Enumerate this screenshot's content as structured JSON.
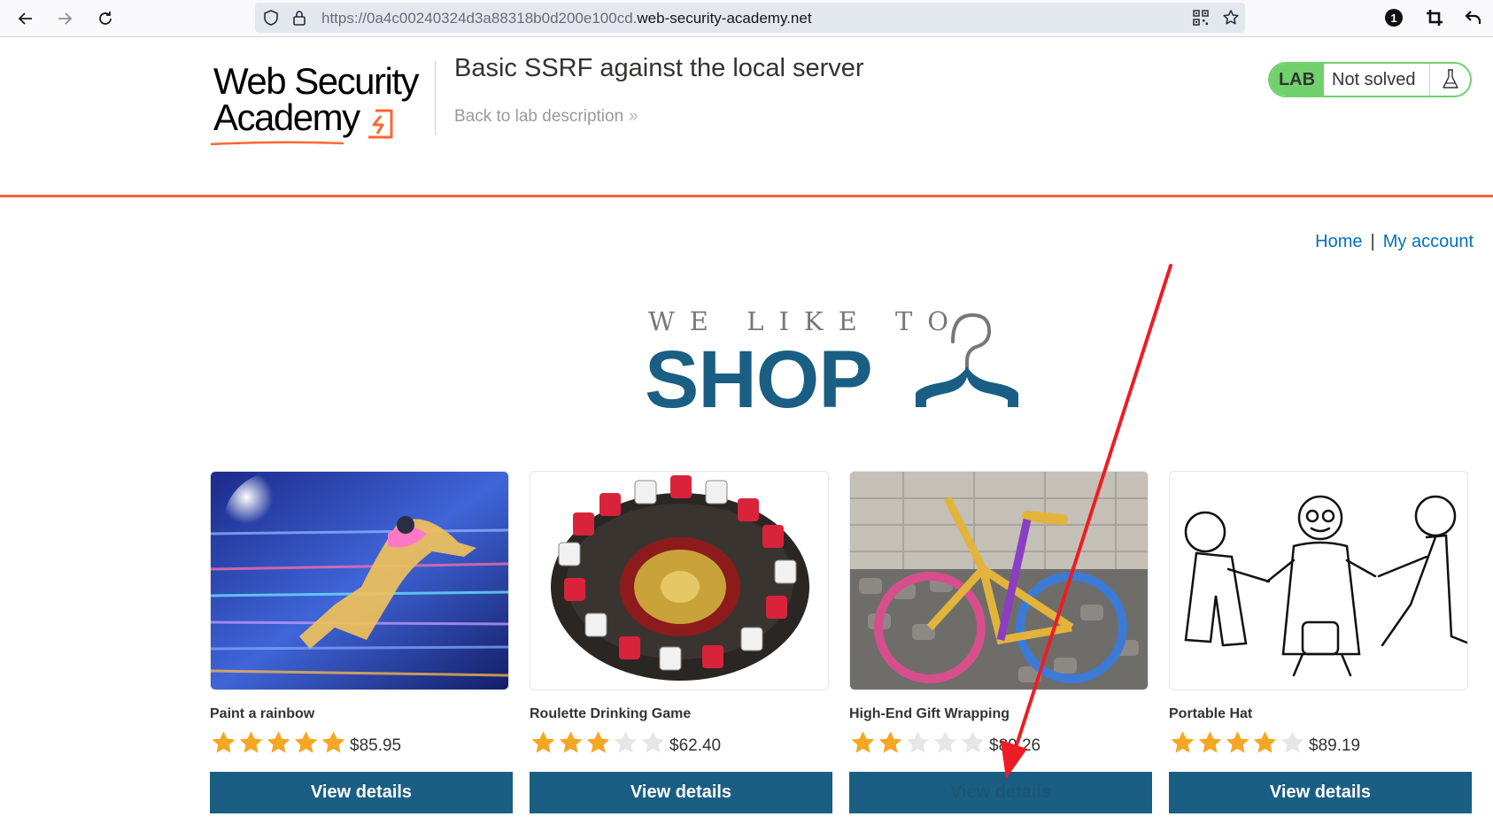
{
  "browser": {
    "url_prefix": "https://0a4c00240324d3a88318b0d200e100cd.",
    "url_domain": "web-security-academy.net",
    "extension_badge": "1"
  },
  "lab": {
    "logo_line1": "Web Security",
    "logo_line2": "Academy",
    "title": "Basic SSRF against the local server",
    "back_link": "Back to lab description",
    "badge": "LAB",
    "status": "Not solved",
    "status_color": "#70d16d",
    "accent_color": "#ff6633"
  },
  "nav": {
    "home": "Home",
    "separator": "|",
    "my_account": "My account"
  },
  "hero": {
    "tagline": "WE LIKE TO",
    "headline": "SHOP",
    "brand_color": "#1a5e84"
  },
  "products": [
    {
      "name": "Paint a rainbow",
      "rating": 5,
      "price": "$85.95",
      "button": "View details"
    },
    {
      "name": "Roulette Drinking Game",
      "rating": 3,
      "price": "$62.40",
      "button": "View details"
    },
    {
      "name": "High-End Gift Wrapping",
      "rating": 2,
      "price": "$89.26",
      "button": "View details"
    },
    {
      "name": "Portable Hat",
      "rating": 4,
      "price": "$89.19",
      "button": "View details"
    }
  ]
}
